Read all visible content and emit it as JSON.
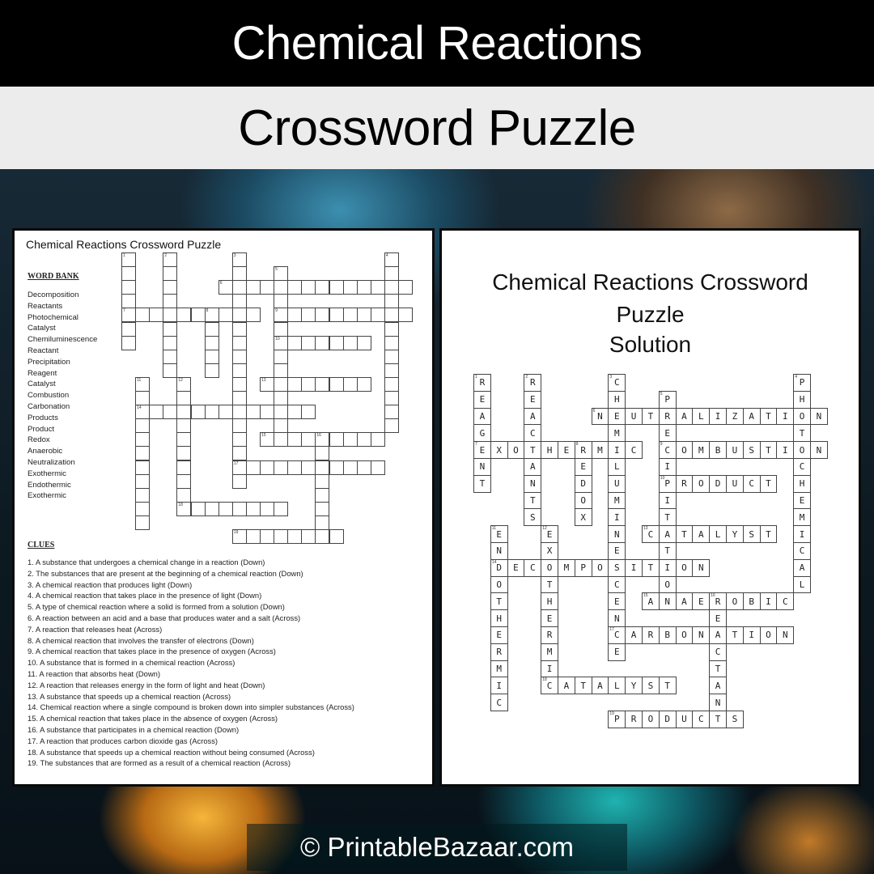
{
  "header": {
    "title": "Chemical Reactions",
    "subtitle": "Crossword Puzzle"
  },
  "puzzle_sheet": {
    "title": "Chemical Reactions Crossword Puzzle",
    "word_bank_label": "WORD BANK",
    "word_bank": [
      "Decomposition",
      "Reactants",
      "Photochemical",
      "Catalyst",
      "Chemiluminescence",
      "Reactant",
      "Precipitation",
      "Reagent",
      "Catalyst",
      "Combustion",
      "Carbonation",
      "Products",
      "Product",
      "Redox",
      "Anaerobic",
      "Neutralization",
      "Exothermic",
      "Endothermic",
      "Exothermic"
    ],
    "clues_label": "CLUES",
    "clues": [
      "1. A substance that undergoes a chemical change in a reaction (Down)",
      "2. The substances that are present at the beginning of a chemical reaction (Down)",
      "3. A chemical reaction that produces light (Down)",
      "4. A chemical reaction that takes place in the presence of light (Down)",
      "5. A type of chemical reaction where a solid is formed from a solution (Down)",
      "6. A reaction between an acid and a base that produces water and a salt (Across)",
      "7. A reaction that releases heat (Across)",
      "8. A chemical reaction that involves the transfer of electrons (Down)",
      "9. A chemical reaction that takes place in the presence of oxygen (Across)",
      "10. A substance that is formed in a chemical reaction (Across)",
      "11. A reaction that absorbs heat (Down)",
      "12. A reaction that releases energy in the form of light and heat (Down)",
      "13. A substance that speeds up a chemical reaction (Across)",
      "14. Chemical reaction where a single compound is broken down into simpler substances (Across)",
      "15. A chemical reaction that takes place in the absence of oxygen (Across)",
      "16. A substance that participates in a chemical reaction (Down)",
      "17. A reaction that produces carbon dioxide gas (Across)",
      "18. A substance that speeds up a chemical reaction without being consumed (Across)",
      "19. The substances that are formed as a result of a chemical reaction (Across)"
    ]
  },
  "solution_sheet": {
    "title_line1": "Chemical Reactions Crossword",
    "title_line2": "Puzzle",
    "title_line3": "Solution"
  },
  "crossword": {
    "entries": [
      {
        "num": 1,
        "dir": "down",
        "row": 0,
        "col": 0,
        "answer": "REAGENT"
      },
      {
        "num": 2,
        "dir": "down",
        "row": 0,
        "col": 3,
        "answer": "REACTANTS"
      },
      {
        "num": 3,
        "dir": "down",
        "row": 0,
        "col": 8,
        "answer": "CHEMILUMINESCENCE"
      },
      {
        "num": 4,
        "dir": "down",
        "row": 0,
        "col": 19,
        "answer": "PHOTOCHEMICAL"
      },
      {
        "num": 5,
        "dir": "down",
        "row": 1,
        "col": 11,
        "answer": "PRECIPITATION"
      },
      {
        "num": 6,
        "dir": "across",
        "row": 2,
        "col": 7,
        "answer": "NEUTRALIZATION"
      },
      {
        "num": 7,
        "dir": "across",
        "row": 4,
        "col": 0,
        "answer": "EXOTHERMIC"
      },
      {
        "num": 8,
        "dir": "down",
        "row": 4,
        "col": 6,
        "answer": "REDOX"
      },
      {
        "num": 9,
        "dir": "across",
        "row": 4,
        "col": 11,
        "answer": "COMBUSTION"
      },
      {
        "num": 10,
        "dir": "across",
        "row": 6,
        "col": 11,
        "answer": "PRODUCT"
      },
      {
        "num": 11,
        "dir": "down",
        "row": 9,
        "col": 1,
        "answer": "ENDOTHERMIC"
      },
      {
        "num": 12,
        "dir": "down",
        "row": 9,
        "col": 4,
        "answer": "EXOTHERMIC"
      },
      {
        "num": 13,
        "dir": "across",
        "row": 9,
        "col": 10,
        "answer": "CATALYST"
      },
      {
        "num": 14,
        "dir": "across",
        "row": 11,
        "col": 1,
        "answer": "DECOMPOSITION"
      },
      {
        "num": 15,
        "dir": "across",
        "row": 13,
        "col": 10,
        "answer": "ANAEROBIC"
      },
      {
        "num": 16,
        "dir": "down",
        "row": 13,
        "col": 14,
        "answer": "REACTANT"
      },
      {
        "num": 17,
        "dir": "across",
        "row": 15,
        "col": 8,
        "answer": "CARBONATION"
      },
      {
        "num": 18,
        "dir": "across",
        "row": 18,
        "col": 4,
        "answer": "CATALYST"
      },
      {
        "num": 19,
        "dir": "across",
        "row": 20,
        "col": 8,
        "answer": "PRODUCTS"
      }
    ]
  },
  "footer": {
    "copyright": "© PrintableBazaar.com"
  }
}
